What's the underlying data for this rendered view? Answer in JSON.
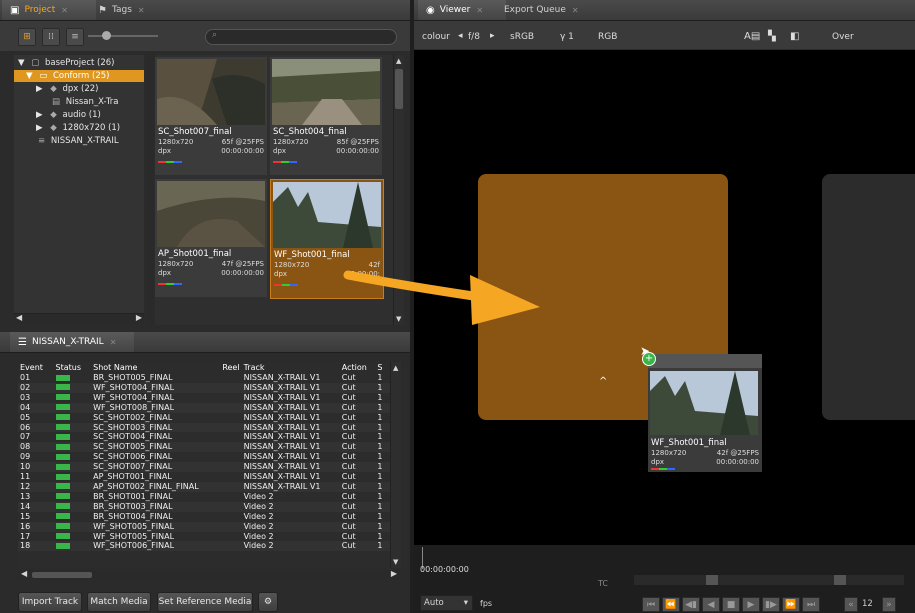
{
  "project_panel": {
    "tabs": [
      {
        "label": "Project",
        "icon": "project-icon"
      },
      {
        "label": "Tags",
        "icon": "tags-icon"
      }
    ],
    "tree": [
      {
        "label": "baseProject (26)",
        "icon": "project-icon"
      },
      {
        "label": "Conform (25)",
        "icon": "folder-icon",
        "selected": true
      },
      {
        "label": "dpx (22)",
        "icon": "bin-icon"
      },
      {
        "label": "Nissan_X-Tra",
        "icon": "clip-icon"
      },
      {
        "label": "audio (1)",
        "icon": "bin-icon"
      },
      {
        "label": "1280x720 (1)",
        "icon": "bin-icon"
      },
      {
        "label": "NISSAN_X-TRAIL",
        "icon": "sequence-icon"
      }
    ],
    "clips": [
      {
        "name": "SC_Shot007_final",
        "res": "1280x720",
        "frames": "65f @25FPS",
        "format": "dpx",
        "tc": "00:00:00:00"
      },
      {
        "name": "SC_Shot004_final",
        "res": "1280x720",
        "frames": "85f @25FPS",
        "format": "dpx",
        "tc": "00:00:00:00"
      },
      {
        "name": "AP_Shot001_final",
        "res": "1280x720",
        "frames": "47f @25FPS",
        "format": "dpx",
        "tc": "00:00:00:00"
      },
      {
        "name": "WF_Shot001_final",
        "res": "1280x720",
        "frames": "42f",
        "format": "dpx",
        "tc": "00:00:00:"
      }
    ]
  },
  "sequence_panel": {
    "title": "NISSAN_X-TRAIL",
    "columns": [
      "Event",
      "Status",
      "Shot Name",
      "Reel",
      "Track",
      "Action",
      "S"
    ],
    "rows": [
      [
        "01",
        "BR_SHOT005_FINAL",
        "NISSAN_X-TRAIL V1",
        "Cut",
        "1"
      ],
      [
        "02",
        "WF_SHOT004_FINAL",
        "NISSAN_X-TRAIL V1",
        "Cut",
        "1"
      ],
      [
        "03",
        "WF_SHOT004_FINAL",
        "NISSAN_X-TRAIL V1",
        "Cut",
        "1"
      ],
      [
        "04",
        "WF_SHOT008_FINAL",
        "NISSAN_X-TRAIL V1",
        "Cut",
        "1"
      ],
      [
        "05",
        "SC_SHOT002_FINAL",
        "NISSAN_X-TRAIL V1",
        "Cut",
        "1"
      ],
      [
        "06",
        "SC_SHOT003_FINAL",
        "NISSAN_X-TRAIL V1",
        "Cut",
        "1"
      ],
      [
        "07",
        "SC_SHOT004_FINAL",
        "NISSAN_X-TRAIL V1",
        "Cut",
        "1"
      ],
      [
        "08",
        "SC_SHOT005_FINAL",
        "NISSAN_X-TRAIL V1",
        "Cut",
        "1"
      ],
      [
        "09",
        "SC_SHOT006_FINAL",
        "NISSAN_X-TRAIL V1",
        "Cut",
        "1"
      ],
      [
        "10",
        "SC_SHOT007_FINAL",
        "NISSAN_X-TRAIL V1",
        "Cut",
        "1"
      ],
      [
        "11",
        "AP_SHOT001_FINAL",
        "NISSAN_X-TRAIL V1",
        "Cut",
        "1"
      ],
      [
        "12",
        "AP_SHOT002_FINAL_FINAL",
        "NISSAN_X-TRAIL V1",
        "Cut",
        "1"
      ],
      [
        "13",
        "BR_SHOT001_FINAL",
        "Video 2",
        "Cut",
        "1"
      ],
      [
        "14",
        "BR_SHOT003_FINAL",
        "Video 2",
        "Cut",
        "1"
      ],
      [
        "15",
        "BR_SHOT004_FINAL",
        "Video 2",
        "Cut",
        "1"
      ],
      [
        "16",
        "WF_SHOT005_FINAL",
        "Video 2",
        "Cut",
        "1"
      ],
      [
        "17",
        "WF_SHOT005_FINAL",
        "Video 2",
        "Cut",
        "1"
      ],
      [
        "18",
        "WF_SHOT006_FINAL",
        "Video 2",
        "Cut",
        "1"
      ]
    ],
    "buttons": {
      "import": "Import Track",
      "match": "Match Media",
      "set_ref": "Set Reference Media"
    }
  },
  "viewer": {
    "tabs": [
      {
        "label": "Viewer",
        "icon": "eye-icon"
      },
      {
        "label": "Export Queue"
      }
    ],
    "toolbar": {
      "channel": "colour",
      "fstop": "f/8",
      "lut": "sRGB",
      "gamma": "γ 1",
      "mode": "RGB",
      "blend": "Over"
    },
    "drag_clip": {
      "name": "WF_Shot001_final",
      "res": "1280x720",
      "frames": "42f @25FPS",
      "format": "dpx",
      "tc": "00:00:00:00"
    },
    "timecode": "00:00:00:00",
    "tc_label": "TC",
    "playback": {
      "rate_mode": "Auto",
      "fps_label": "fps",
      "step": "12"
    },
    "colors": {
      "slot": "#8a5512",
      "accent": "#f5a623",
      "status_ok": "#39b54a"
    }
  }
}
